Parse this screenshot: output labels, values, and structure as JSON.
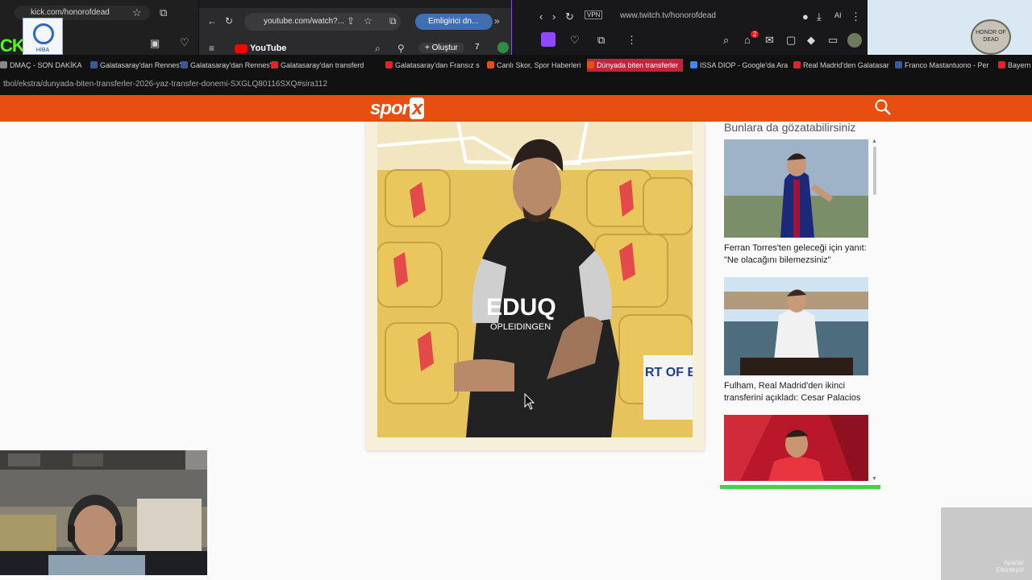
{
  "windows": {
    "left": {
      "url": "kick.com/honorofdead",
      "logo_text": "HİBA",
      "brand_fragment": "CKT"
    },
    "middle": {
      "url": "youtube.com/watch?...",
      "pill_label": "Emligirici dn...",
      "youtube_label": "YouTube",
      "create_label": "Oluştur",
      "notif_count": "7"
    },
    "right": {
      "url": "www.twitch.tv/honorofdead",
      "notif_count": "2",
      "ai_label": "AI"
    },
    "far": {
      "seal_text": "HONOR OF DEAD"
    }
  },
  "bookmarks": [
    {
      "label": "DMAÇ - SON DAKİKA",
      "color": "#888888",
      "active": false
    },
    {
      "label": "Galatasaray'dan Rennes'in",
      "color": "#3b5998",
      "active": false
    },
    {
      "label": "Galatasaray'dan Rennes'in",
      "color": "#3b5998",
      "active": false
    },
    {
      "label": "Galatasaray'dan transferd",
      "color": "#e0242b",
      "active": false
    },
    {
      "label": "Galatasaray'dan Fransız s",
      "color": "#e0242b",
      "active": false
    },
    {
      "label": "Canlı Skor, Spor Haberleri",
      "color": "#e84e0f",
      "active": false
    },
    {
      "label": "Dünyada biten transferler",
      "color": "#e84e0f",
      "active": true
    },
    {
      "label": "ISSA DIOP - Google'da Ara",
      "color": "#4285f4",
      "active": false
    },
    {
      "label": "Real Madrid'den Galatasar",
      "color": "#e0242b",
      "active": false
    },
    {
      "label": "Franco Mastantuono - Per",
      "color": "#3b5998",
      "active": false
    },
    {
      "label": "Bayern",
      "color": "#e0242b",
      "active": false
    }
  ],
  "status_url": "tbol/ekstra/dunyada-biten-transferler-2026-yaz-transfer-donemi-SXGLQ80116SXQ#sira112",
  "sporx": {
    "logo_main": "spor",
    "logo_x": "x"
  },
  "main_photo": {
    "shirt_text": "EDUQ",
    "shirt_sub": "OPLEIDINGEN",
    "banner_text": "RT OF ERGY"
  },
  "sidebar": {
    "title": "Bunlara da gözatabilirsiniz",
    "cards": [
      {
        "headline": "Ferran Torres'ten geleceği için yanıt: \"Ne olacağını bilemezsiniz\""
      },
      {
        "headline": "Fulham, Real Madrid'den ikinci transferini açıkladı: Cesar Palacios"
      },
      {
        "headline": ""
      }
    ]
  },
  "corner_text": "Ayarlar\nEtkinleştir",
  "colors": {
    "sporx_orange": "#e84e0f",
    "twitch_purple": "#9146ff",
    "kick_green": "#53fc18",
    "highlight_green": "#47d14a"
  }
}
